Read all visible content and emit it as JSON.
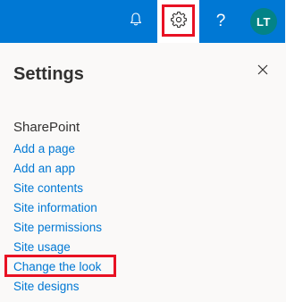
{
  "topbar": {
    "bell_icon": "bell-icon",
    "gear_icon": "gear-icon",
    "help_label": "?",
    "avatar_initials": "LT",
    "colors": {
      "bar": "#0078d4",
      "avatar": "#038387",
      "highlight": "#e81123"
    }
  },
  "panel": {
    "title": "Settings",
    "close_icon": "close-icon",
    "section_heading": "SharePoint",
    "links": [
      "Add a page",
      "Add an app",
      "Site contents",
      "Site information",
      "Site permissions",
      "Site usage",
      "Change the look",
      "Site designs"
    ],
    "link_color": "#0078d4"
  }
}
